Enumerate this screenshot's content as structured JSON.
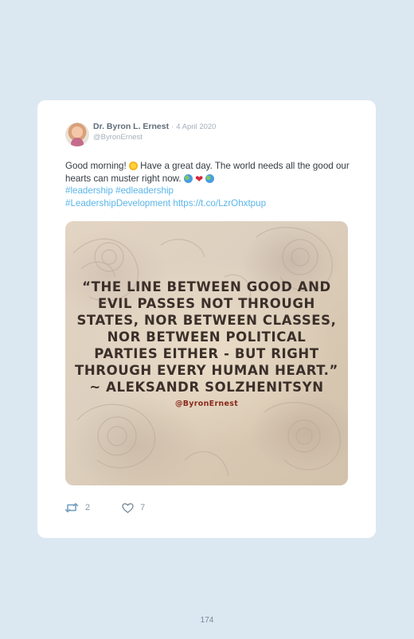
{
  "tweet": {
    "display_name": "Dr. Byron L. Ernest",
    "date_separator": "·",
    "date": "4 April 2020",
    "handle": "@ByronErnest",
    "text_part1": "Good morning!",
    "text_part2": "Have a great day. The world needs all the good our hearts can muster right now.",
    "hashtags_line1": "#leadership #edleadership",
    "hashtags_line2": "#LeadershipDevelopment",
    "link": "https://t.co/LzrOhxtpup",
    "emoji_names": [
      "sun-emoji",
      "globe-emoji",
      "heart-emoji",
      "globe-emoji"
    ]
  },
  "image": {
    "quote": "“The line between good and evil passes not through states, nor between classes, nor between political parties either - but right through every human heart.” ~ Aleksandr Solzhenitsyn",
    "credit": "@ByronErnest"
  },
  "actions": {
    "retweet_count": "2",
    "like_count": "7"
  },
  "page": {
    "number": "174"
  },
  "colors": {
    "background": "#dbe8f2",
    "card": "#ffffff",
    "link": "#5ab5e9",
    "muted": "#a4b0bb"
  }
}
